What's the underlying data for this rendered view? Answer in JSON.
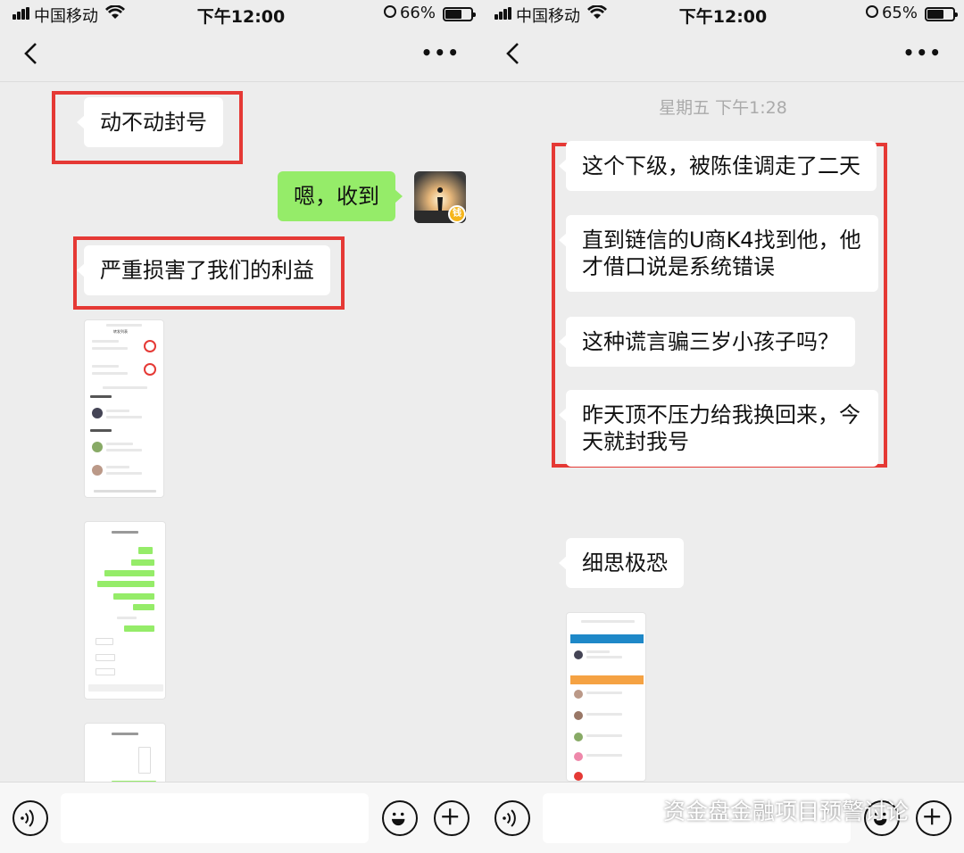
{
  "left_screen": {
    "status": {
      "carrier": "中国移动",
      "time": "下午12:00",
      "battery": "66%",
      "battery_level": 0.66
    },
    "messages": [
      {
        "from": "other",
        "text": "动不动封号",
        "highlighted": true
      },
      {
        "from": "me",
        "text": "嗯，收到"
      },
      {
        "from": "other",
        "text": "严重损害了我们的利益",
        "highlighted": true
      },
      {
        "from": "other",
        "type": "image",
        "content": "app-screenshot-list"
      },
      {
        "from": "other",
        "type": "image",
        "content": "chat-screenshot"
      },
      {
        "from": "other",
        "type": "image",
        "content": "chat-screenshot-partial"
      }
    ]
  },
  "right_screen": {
    "status": {
      "carrier": "中国移动",
      "time": "下午12:00",
      "battery": "65%",
      "battery_level": 0.65
    },
    "timestamp": "星期五 下午1:28",
    "messages": [
      {
        "from": "other",
        "text": "这个下级，被陈佳调走了二天",
        "highlighted": true
      },
      {
        "from": "other",
        "lines": [
          "直到链信的U商K4找到他，他",
          "才借口说是系统错误"
        ],
        "highlighted": true
      },
      {
        "from": "other",
        "text": "这种谎言骗三岁小孩子吗？",
        "highlighted": true
      },
      {
        "from": "other",
        "lines": [
          "昨天顶不压力给我换回来，今",
          "天就封我号"
        ],
        "highlighted": true
      },
      {
        "from": "other",
        "text": "细思极恐"
      },
      {
        "from": "other",
        "type": "image",
        "content": "app-screenshot-list"
      }
    ]
  },
  "watermark": "资金盘金融项目预警讨论",
  "icons": [
    "back-icon",
    "more-icon",
    "voice-icon",
    "emoji-icon",
    "plus-icon",
    "signal-icon",
    "wifi-icon",
    "battery-icon",
    "lock-rotation-icon",
    "wechat-logo-icon"
  ],
  "colors": {
    "chat_bg": "#ededed",
    "bubble_in": "#ffffff",
    "bubble_out": "#95ec69",
    "highlight_box": "#e53935"
  }
}
